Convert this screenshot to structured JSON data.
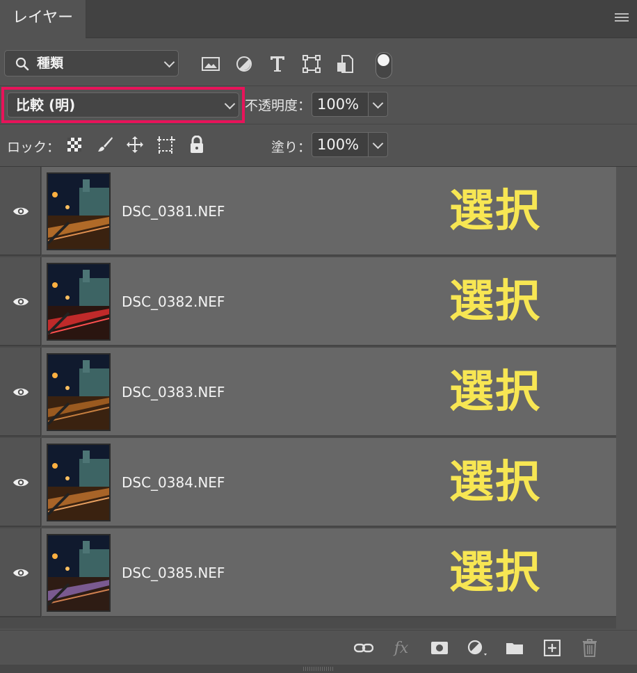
{
  "panel": {
    "tab_label": "レイヤー",
    "menu_icon": "hamburger-menu-icon"
  },
  "filter": {
    "selected": "種類",
    "icons": [
      "image-filter-icon",
      "adjustment-filter-icon",
      "type-filter-icon",
      "shape-filter-icon",
      "smart-object-filter-icon",
      "filter-toggle-icon"
    ]
  },
  "blend": {
    "mode": "比較 (明)",
    "highlight_color": "#e8135a"
  },
  "opacity": {
    "label": "不透明度：",
    "value": "100%"
  },
  "lock": {
    "label": "ロック：",
    "icons": [
      "lock-transparent-pixels-icon",
      "lock-image-pixels-icon",
      "lock-position-icon",
      "lock-artboard-icon",
      "lock-all-icon"
    ]
  },
  "fill": {
    "label": "塗り：",
    "value": "100%"
  },
  "layers": [
    {
      "name": "DSC_0381.NEF",
      "tag": "選択"
    },
    {
      "name": "DSC_0382.NEF",
      "tag": "選択"
    },
    {
      "name": "DSC_0383.NEF",
      "tag": "選択"
    },
    {
      "name": "DSC_0384.NEF",
      "tag": "選択"
    },
    {
      "name": "DSC_0385.NEF",
      "tag": "選択"
    }
  ],
  "tag_color": "#f7e653",
  "bottom_toolbar": {
    "fx_label": "fx",
    "icons": [
      "link-layers-icon",
      "fx-icon",
      "add-mask-icon",
      "adjustment-layer-icon",
      "new-group-icon",
      "new-layer-icon",
      "delete-icon"
    ]
  }
}
